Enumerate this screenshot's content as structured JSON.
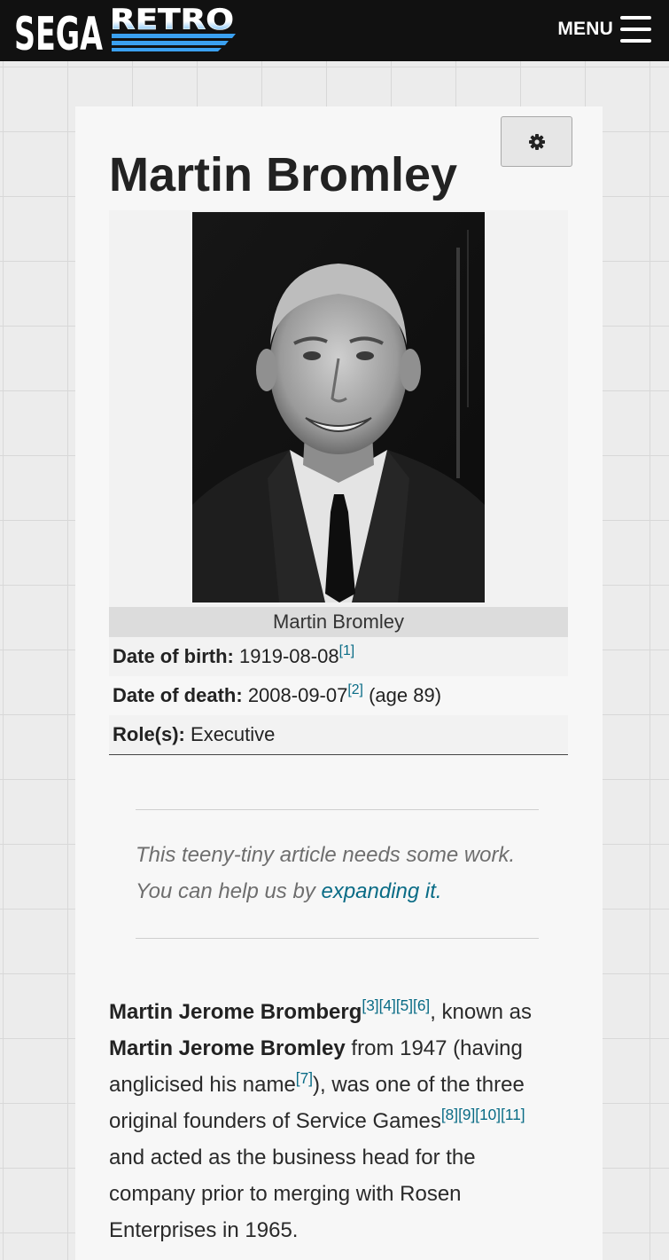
{
  "header": {
    "logo_left": "SEGA",
    "logo_right": "RETRO",
    "menu_label": "MENU"
  },
  "colors": {
    "topbar": "#111111",
    "logo_white": "#ffffff",
    "logo_blue": "#3aa0f0",
    "link": "#0a6c86",
    "card": "#f7f7f7",
    "page_background": "#ececec"
  },
  "icons": {
    "menu": "hamburger-icon",
    "settings": "gear-icon"
  },
  "page": {
    "title": "Martin Bromley"
  },
  "infobox": {
    "caption": "Martin Bromley",
    "rows": [
      {
        "label": "Date of birth:",
        "value": "1919-08-08",
        "refs": [
          "[1]"
        ],
        "suffix": ""
      },
      {
        "label": "Date of death:",
        "value": "2008-09-07",
        "refs": [
          "[2]"
        ],
        "suffix": " (age 89)"
      },
      {
        "label": "Role(s):",
        "value": "Executive",
        "refs": [],
        "suffix": ""
      }
    ]
  },
  "stub": {
    "line1": "This teeny-tiny article needs some work.",
    "line2_prefix": "You can help us by ",
    "line2_link": "expanding it."
  },
  "article": {
    "lines": [
      {
        "bold": "Martin Jerome Bromberg",
        "refs": [
          "[3]",
          "[4]",
          "[5]",
          "[6]"
        ],
        "text": ", known as"
      },
      {
        "bold": "Martin Jerome Bromley",
        "text": " from 1947 (having"
      },
      {
        "text": "anglicised his name",
        "refs": [
          "[7]"
        ],
        "text_after": "), was one of the three"
      },
      {
        "text": "original founders of Service Games",
        "refs": [
          "[8]",
          "[9]",
          "[10]",
          "[11]"
        ]
      },
      {
        "text": "and acted as the business head for the"
      },
      {
        "text": "company prior to merging with Rosen"
      },
      {
        "text": "Enterprises in 1965."
      }
    ]
  }
}
